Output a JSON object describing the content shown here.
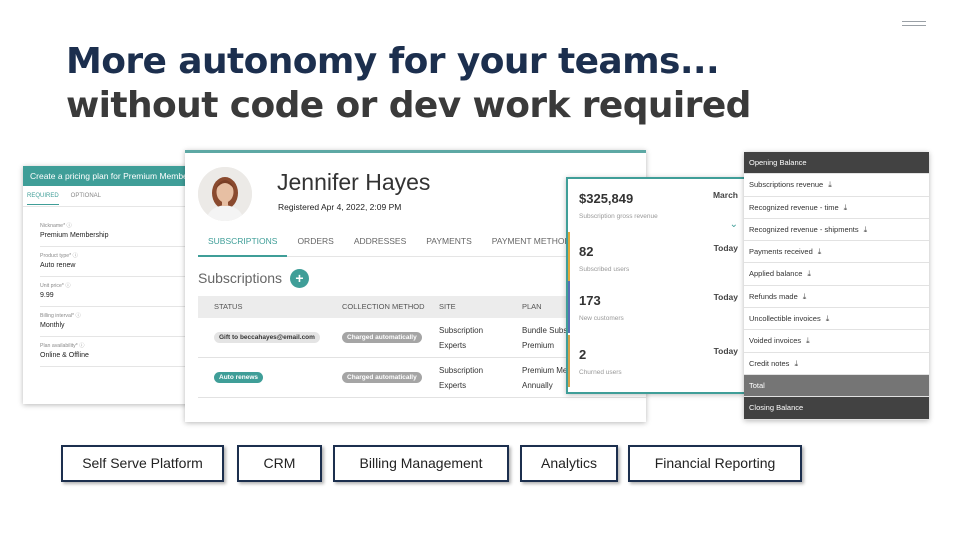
{
  "headline": {
    "line1": "More autonomy for your teams...",
    "line2": "without code or dev work required"
  },
  "pricing_card": {
    "header": "Create a pricing plan for Premium Membership",
    "tabs": [
      "REQUIRED",
      "OPTIONAL"
    ],
    "fields": [
      {
        "label": "Nickname* ⓘ",
        "value": "Premium Membership"
      },
      {
        "label": "Product type* ⓘ",
        "value": "Auto renew"
      },
      {
        "label": "Unit price* ⓘ",
        "value": "9.99"
      },
      {
        "label": "Billing interval* ⓘ",
        "value": "Monthly"
      },
      {
        "label": "Plan availability* ⓘ",
        "value": "Online & Offline"
      }
    ]
  },
  "profile_card": {
    "name": "Jennifer Hayes",
    "registered": "Registered Apr 4, 2022, 2:09 PM",
    "tabs": [
      "SUBSCRIPTIONS",
      "ORDERS",
      "ADDRESSES",
      "PAYMENTS",
      "PAYMENT METHODS"
    ],
    "section_title": "Subscriptions",
    "add_symbol": "+",
    "columns": [
      "STATUS",
      "COLLECTION METHOD",
      "SITE",
      "PLAN"
    ],
    "rows": [
      {
        "status": "Gift to beccahayes@email.com",
        "collection": "Charged automatically",
        "site_line1": "Subscription",
        "site_line2": "Experts",
        "plan_line1": "Bundle Subscription",
        "plan_line2": "Premium"
      },
      {
        "status": "Auto renews",
        "collection": "Charged automatically",
        "site_line1": "Subscription",
        "site_line2": "Experts",
        "plan_line1": "Premium Membership",
        "plan_line2": "Annually"
      }
    ]
  },
  "metrics_card": {
    "metrics": [
      {
        "value": "$325,849",
        "label": "Subscription gross revenue",
        "period": "March",
        "color": "#ffffff"
      },
      {
        "value": "82",
        "label": "Subscribed users",
        "period": "Today",
        "color": "#e0a93a"
      },
      {
        "value": "173",
        "label": "New customers",
        "period": "Today",
        "color": "#5a6fb5"
      },
      {
        "value": "2",
        "label": "Churned users",
        "period": "Today",
        "color": "#d3a24a"
      }
    ]
  },
  "accounting_card": {
    "opening": "Opening Balance",
    "items": [
      "Subscriptions revenue",
      "Recognized revenue - time",
      "Recognized revenue - shipments",
      "Payments received",
      "Applied balance",
      "Refunds made",
      "Uncollectible invoices",
      "Voided invoices",
      "Credit notes"
    ],
    "total": "Total",
    "closing": "Closing Balance"
  },
  "products": [
    "Self Serve Platform",
    "CRM",
    "Billing Management",
    "Analytics",
    "Financial Reporting"
  ],
  "colors": {
    "teal": "#3f9e98",
    "navy": "#1c2f4e"
  }
}
